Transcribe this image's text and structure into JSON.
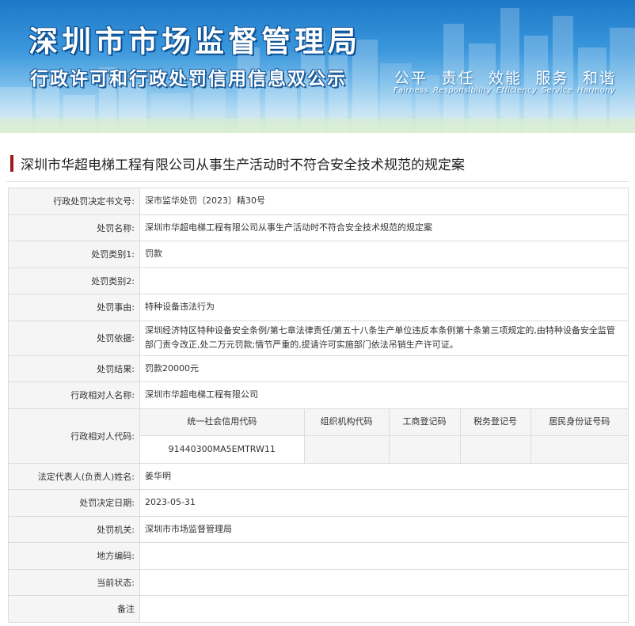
{
  "banner": {
    "title": "深圳市市场监督管理局",
    "subtitle": "行政许可和行政处罚信用信息双公示",
    "slogan": [
      "公平",
      "责任",
      "效能",
      "服务",
      "和谐"
    ],
    "slogan_en": [
      "Fairness",
      "Responsibility",
      "Efficiency",
      "Service",
      "Harmony"
    ]
  },
  "heading": "深圳市华超电梯工程有限公司从事生产活动时不符合安全技术规范的规定案",
  "rows": [
    {
      "label": "行政处罚决定书文号:",
      "value": "深市监华处罚〔2023〕精30号"
    },
    {
      "label": "处罚名称:",
      "value": "深圳市华超电梯工程有限公司从事生产活动时不符合安全技术规范的规定案"
    },
    {
      "label": "处罚类别1:",
      "value": "罚款"
    },
    {
      "label": "处罚类别2:",
      "value": ""
    },
    {
      "label": "处罚事由:",
      "value": "特种设备违法行为"
    },
    {
      "label": "处罚依据:",
      "value": "深圳经济特区特种设备安全条例/第七章法律责任/第五十八条生产单位违反本条例第十条第三项规定的,由特种设备安全监管部门责令改正,处二万元罚款;情节严重的,提请许可实施部门依法吊销生产许可证。"
    },
    {
      "label": "处罚结果:",
      "value": "罚款20000元"
    },
    {
      "label": "行政相对人名称:",
      "value": "深圳市华超电梯工程有限公司"
    }
  ],
  "codes": {
    "label": "行政相对人代码:",
    "headers": [
      "统一社会信用代码",
      "组织机构代码",
      "工商登记码",
      "税务登记号",
      "居民身份证号码"
    ],
    "values": [
      "91440300MA5EMTRW11",
      "",
      "",
      "",
      ""
    ]
  },
  "rows2": [
    {
      "label": "法定代表人(负责人)姓名:",
      "value": "姜华明"
    },
    {
      "label": "处罚决定日期:",
      "value": "2023-05-31"
    },
    {
      "label": "处罚机关:",
      "value": "深圳市市场监督管理局"
    },
    {
      "label": "地方编码:",
      "value": ""
    },
    {
      "label": "当前状态:",
      "value": ""
    },
    {
      "label": "备注",
      "value": ""
    }
  ]
}
